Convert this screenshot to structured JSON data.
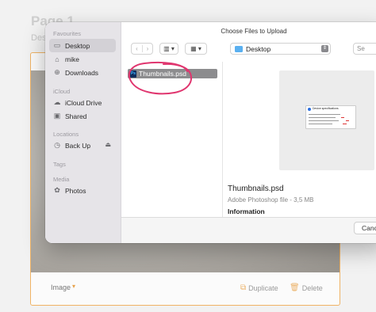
{
  "background": {
    "page_title": "Page 1",
    "page_desc": "Des",
    "footer": {
      "image_label": "Image",
      "image_caret": "▾",
      "duplicate_label": "Duplicate",
      "delete_label": "Delete"
    }
  },
  "dialog": {
    "title": "Choose Files to Upload",
    "sidebar": {
      "sections": [
        {
          "title": "Favourites",
          "items": [
            {
              "label": "Desktop",
              "icon": "desktop-icon",
              "selected": true
            },
            {
              "label": "mike",
              "icon": "home-icon"
            },
            {
              "label": "Downloads",
              "icon": "download-icon"
            }
          ]
        },
        {
          "title": "iCloud",
          "items": [
            {
              "label": "iCloud Drive",
              "icon": "cloud-icon"
            },
            {
              "label": "Shared",
              "icon": "shared-folder-icon"
            }
          ]
        },
        {
          "title": "Locations",
          "items": [
            {
              "label": "Back Up",
              "icon": "clock-icon"
            }
          ]
        },
        {
          "title": "Tags",
          "items": []
        },
        {
          "title": "Media",
          "items": [
            {
              "label": "Photos",
              "icon": "photos-icon"
            }
          ]
        }
      ]
    },
    "toolbar": {
      "location": "Desktop",
      "search_placeholder": "Se"
    },
    "files": [
      {
        "name": "Thumbnails.psd",
        "selected": true
      }
    ],
    "preview": {
      "name": "Thumbnails.psd",
      "kind": "Adobe Photoshop file - 3,5 MB",
      "info_heading": "Information",
      "thumbnail_text": "Device specifications"
    },
    "buttons": {
      "cancel": "Cance"
    }
  },
  "colors": {
    "accent_orange": "#f0b365",
    "annotation_pink": "#e0366f",
    "selection_gray": "#8c8c8e"
  }
}
